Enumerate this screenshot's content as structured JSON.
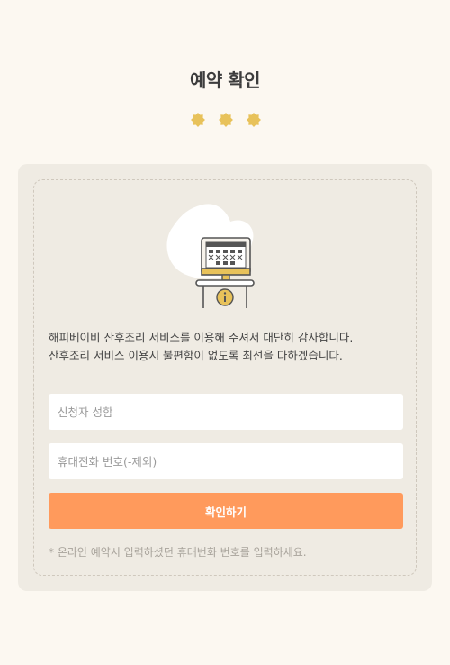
{
  "header": {
    "title": "예약 확인",
    "step_indicator_icons": [
      "flower-dot-icon",
      "flower-dot-icon",
      "flower-dot-icon"
    ],
    "dot_color": "#e8c25a"
  },
  "card": {
    "illustration_icon": "kiosk-info-illustration",
    "message_lines": [
      "해피베이비 산후조리 서비스를 이용해 주셔서 대단히 감사합니다.",
      "산후조리 서비스 이용시 불편함이 없도록 최선을 다하겠습니다."
    ],
    "name_input": {
      "placeholder": "신청자 성함",
      "value": ""
    },
    "phone_input": {
      "placeholder": "휴대전화 번호(-제외)",
      "value": ""
    },
    "submit_label": "확인하기",
    "note": "* 온라인 예약시 입력하셨던 휴대번화 번호를 입력하세요."
  },
  "colors": {
    "background": "#fcf8f1",
    "card": "#efebe3",
    "button": "#ff9a5c",
    "accent": "#e8c25a"
  }
}
